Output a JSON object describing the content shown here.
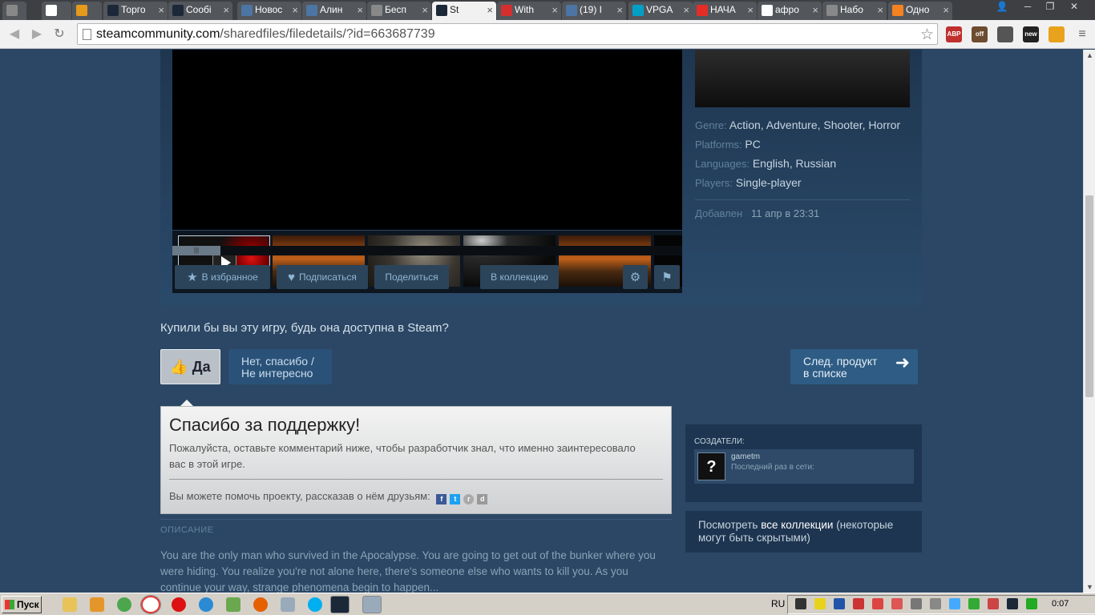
{
  "browser": {
    "tabs": [
      {
        "label": "",
        "icon": "app-icon",
        "color": "#888888"
      },
      {
        "label": "",
        "icon": "google-icon",
        "color": "#ffffff"
      },
      {
        "label": "",
        "icon": "flame-icon",
        "color": "#e59a1c"
      },
      {
        "label": "Торго",
        "icon": "steam-icon",
        "color": "#1b2838"
      },
      {
        "label": "Сообі",
        "icon": "steam-icon",
        "color": "#1b2838"
      },
      {
        "label": "Новос",
        "icon": "vk-icon",
        "color": "#4c75a3"
      },
      {
        "label": "Алин",
        "icon": "vk-icon",
        "color": "#4c75a3"
      },
      {
        "label": "Бесп",
        "icon": "loading-icon",
        "color": "#888888"
      },
      {
        "label": "St",
        "icon": "steam-icon",
        "color": "#1b2838"
      },
      {
        "label": "With",
        "icon": "x2-icon",
        "color": "#d32f2f"
      },
      {
        "label": "(19) I",
        "icon": "vk-icon",
        "color": "#4c75a3"
      },
      {
        "label": "VPGA",
        "icon": "up-icon",
        "color": "#00a0c6"
      },
      {
        "label": "НАЧА",
        "icon": "youtube-icon",
        "color": "#e52d27"
      },
      {
        "label": "афро",
        "icon": "google-icon",
        "color": "#ffffff"
      },
      {
        "label": "Набо",
        "icon": "app-icon",
        "color": "#888888"
      },
      {
        "label": "Одно",
        "icon": "ok-icon",
        "color": "#f58220"
      }
    ],
    "close_glyph": "×",
    "url_host": "steamcommunity.com",
    "url_path": "/sharedfiles/filedetails/?id=663687739",
    "extensions": [
      {
        "name": "adblock-icon",
        "label": "ABP",
        "color": "#c0302e"
      },
      {
        "name": "ghost-extension-icon",
        "label": "off",
        "color": "#6d4c2f"
      },
      {
        "name": "cs-icon",
        "label": "",
        "color": "#555555"
      },
      {
        "name": "new-extension-icon",
        "label": "new",
        "color": "#222222"
      },
      {
        "name": "fire-extension-icon",
        "label": "",
        "color": "#e8a21c"
      }
    ]
  },
  "page": {
    "actions": {
      "favorite": "В избранное",
      "subscribe": "Подписаться",
      "share": "Поделиться",
      "collection": "В коллекцию"
    },
    "meta": {
      "genre_label": "Genre:",
      "genre": "Action, Adventure, Shooter, Horror",
      "platforms_label": "Platforms:",
      "platforms": "PC",
      "languages_label": "Languages:",
      "languages": "English, Russian",
      "players_label": "Players:",
      "players": "Single-player",
      "added_label": "Добавлен",
      "added": "11 апр в 23:31"
    },
    "vote": {
      "question": "Купили бы вы эту игру, будь она доступна в Steam?",
      "yes": "Да",
      "no_line1": "Нет, спасибо /",
      "no_line2": "Не интересно",
      "next_line1": "След. продукт",
      "next_line2": "в списке"
    },
    "thanks": {
      "title": "Спасибо за поддержку!",
      "text": "Пожалуйста, оставьте комментарий ниже, чтобы разработчик знал, что именно заинтересовало вас в этой игре.",
      "share_text": "Вы можете помочь проекту, рассказав о нём друзьям:"
    },
    "description": {
      "heading": "ОПИСАНИЕ",
      "text": "You are the only man who survived in the Apocalypse. You are going to get out of the bunker where you were hiding. You realize you're not alone here, there's someone else who wants to kill you. As you continue your way, strange phenomena begin to happen..."
    },
    "creators": {
      "heading": "СОЗДАТЕЛИ:",
      "name": "gametm",
      "status": "Последний раз в сети:",
      "avatar": "?"
    },
    "collections": {
      "prefix": "Посмотреть ",
      "link": "все коллекции",
      "suffix": " (некоторые могут быть скрытыми)"
    }
  },
  "taskbar": {
    "start": "Пуск",
    "lang": "RU",
    "clock": "0:07"
  },
  "colors": {
    "page_bg": "#2b4765",
    "panel": "#1f3650",
    "accent": "#2e5c84"
  }
}
